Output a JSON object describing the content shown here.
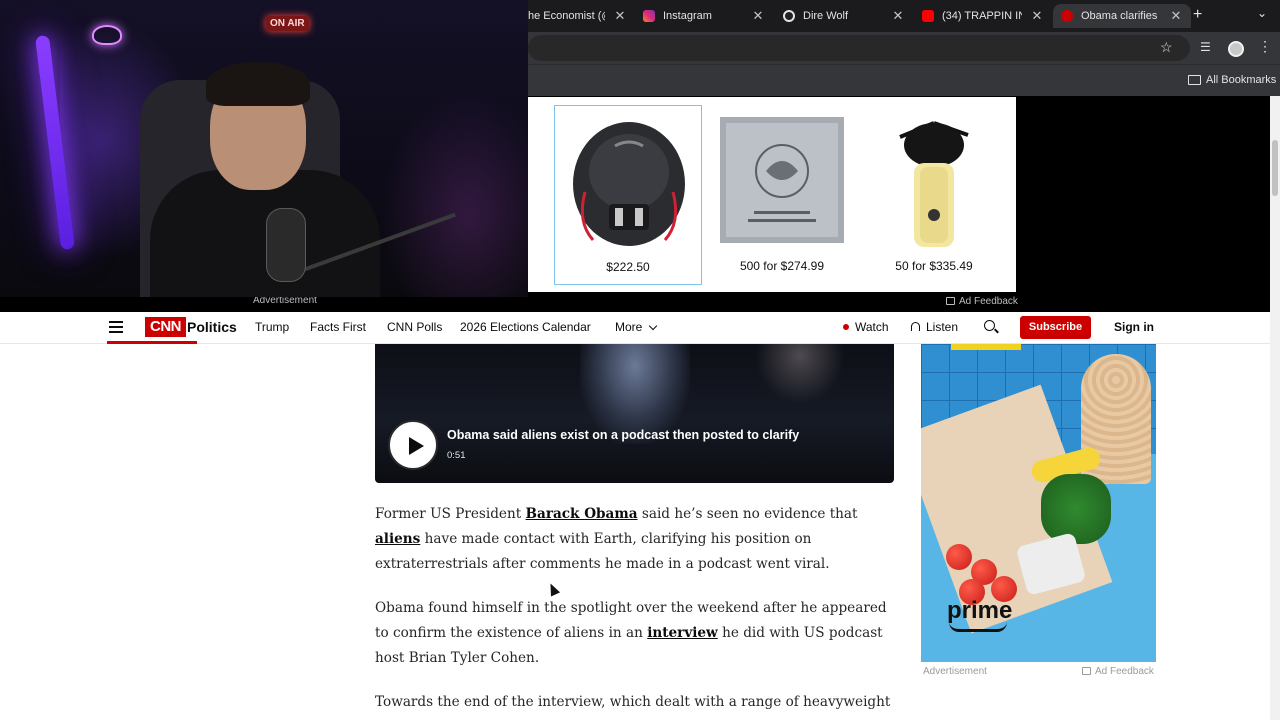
{
  "browser": {
    "tabs": [
      {
        "title": "he Economist (@...",
        "icon": "economist-icon",
        "active": false
      },
      {
        "title": "Instagram",
        "icon": "instagram-icon",
        "active": false
      },
      {
        "title": "Dire Wolf",
        "icon": "threads-icon",
        "active": false
      },
      {
        "title": "(34) TRAPPIN IN ...",
        "icon": "youtube-icon",
        "active": false
      },
      {
        "title": "Obama clarifies al...",
        "icon": "cnn-icon",
        "active": true
      }
    ],
    "new_tab_glyph": "+",
    "close_glyph": "✕",
    "bookmarks": {
      "all_bookmarks": "All Bookmarks"
    }
  },
  "top_ad": {
    "products": [
      {
        "price": "$222.50",
        "image": "backpack"
      },
      {
        "price": "500 for $274.99",
        "image": "sachet"
      },
      {
        "price": "50 for $335.49",
        "image": "feather-bottle"
      }
    ],
    "advertisement_label": "Advertisement",
    "ad_feedback": "Ad Feedback"
  },
  "webcam": {
    "on_air_sign": "ON AIR"
  },
  "cnn_nav": {
    "logo": "CNN",
    "section": "Politics",
    "links": [
      "Trump",
      "Facts First",
      "CNN Polls",
      "2026 Elections Calendar"
    ],
    "more": "More",
    "watch": "Watch",
    "listen": "Listen",
    "subscribe": "Subscribe",
    "sign_in": "Sign in"
  },
  "video": {
    "title": "Obama said aliens exist on a podcast then posted to clarify",
    "duration": "0:51"
  },
  "article": {
    "p1": {
      "t1": "Former US President ",
      "link1": "Barack Obama",
      "t2": " said he’s seen no evidence that ",
      "link2": "aliens",
      "t3": " have made contact with Earth, clarifying his position on extraterrestrials after comments he made in a podcast went viral."
    },
    "p2": {
      "t1": "Obama found himself in the spotlight over the weekend after he appeared to confirm the existence of aliens in an ",
      "link1": "interview",
      "t2": " he did with US podcast host Brian Tyler Cohen."
    },
    "p3": "Towards the end of the interview, which dealt with a range of heavyweight"
  },
  "right_ad": {
    "brand": "prime",
    "advertisement_label": "Advertisement",
    "ad_feedback": "Ad Feedback"
  },
  "colors": {
    "cnn_red": "#cc0000",
    "chrome_dark": "#202124",
    "prime_bg": "#58b6e6"
  }
}
